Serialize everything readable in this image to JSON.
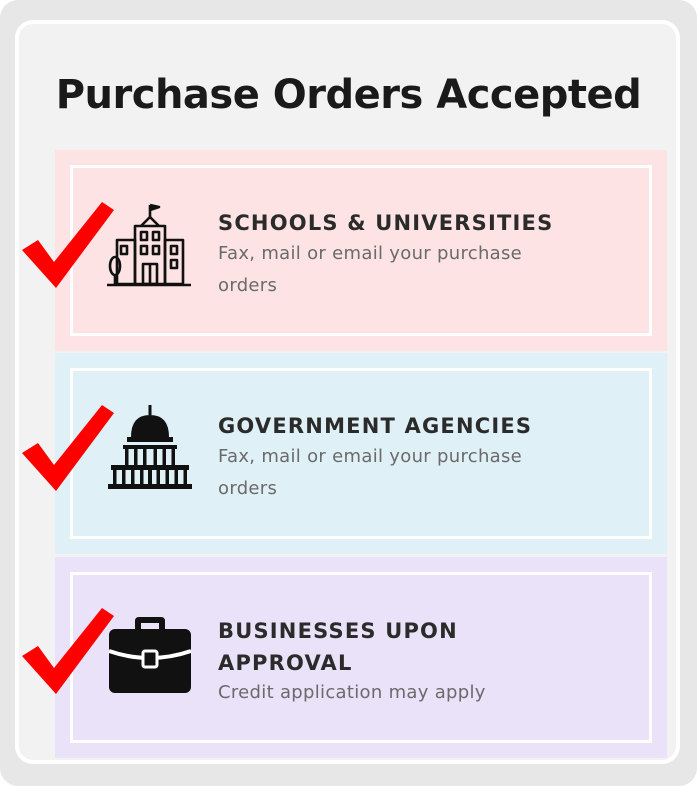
{
  "title": "Purchase Orders Accepted",
  "cards": [
    {
      "heading": "SCHOOLS & UNIVERSITIES",
      "description": "Fax, mail or email your purchase orders",
      "icon": "school-building-icon",
      "color": "#fde3e3"
    },
    {
      "heading": "GOVERNMENT AGENCIES",
      "description": "Fax, mail or email your purchase orders",
      "icon": "capitol-building-icon",
      "color": "#dff0f7"
    },
    {
      "heading": "BUSINESSES UPON APPROVAL",
      "description": "Credit application may apply",
      "icon": "briefcase-icon",
      "color": "#e9e2f8"
    }
  ],
  "check_color": "#ff0000"
}
